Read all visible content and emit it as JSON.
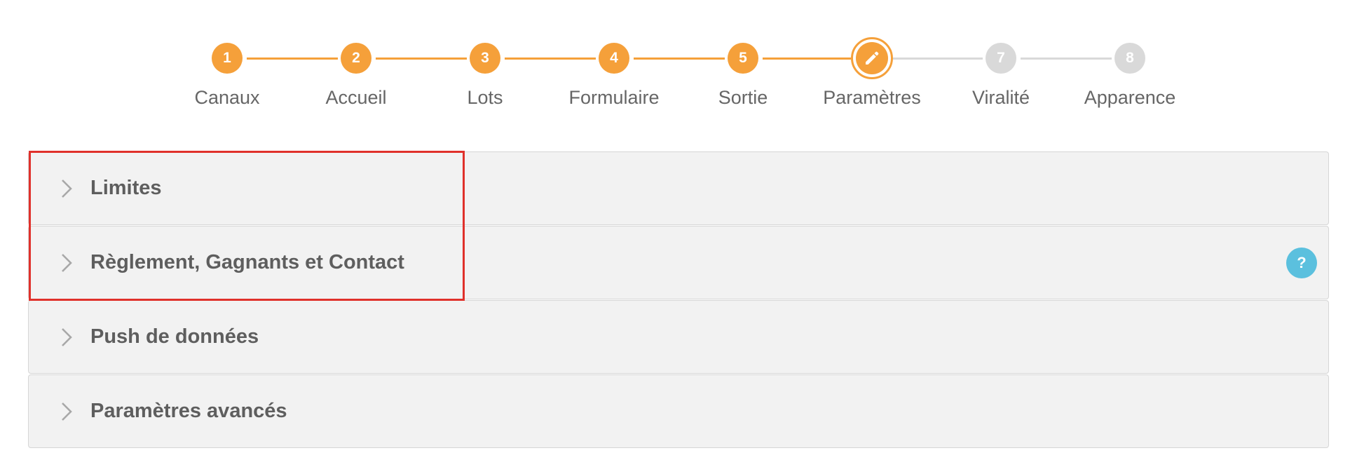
{
  "stepper": {
    "steps": [
      {
        "number": "1",
        "label": "Canaux",
        "state": "done"
      },
      {
        "number": "2",
        "label": "Accueil",
        "state": "done"
      },
      {
        "number": "3",
        "label": "Lots",
        "state": "done"
      },
      {
        "number": "4",
        "label": "Formulaire",
        "state": "done"
      },
      {
        "number": "5",
        "label": "Sortie",
        "state": "done"
      },
      {
        "number": "",
        "label": "Paramètres",
        "state": "current",
        "icon": "pencil-icon"
      },
      {
        "number": "7",
        "label": "Viralité",
        "state": "todo"
      },
      {
        "number": "8",
        "label": "Apparence",
        "state": "todo"
      }
    ]
  },
  "accordion": {
    "panels": [
      {
        "title": "Limites",
        "icon": "chevron-right-icon"
      },
      {
        "title": "Règlement, Gagnants et Contact",
        "icon": "chevron-right-icon",
        "help": "?"
      },
      {
        "title": "Push de données",
        "icon": "chevron-right-icon"
      },
      {
        "title": "Paramètres avancés",
        "icon": "chevron-right-icon"
      }
    ]
  },
  "colors": {
    "accent": "#f5a03a",
    "inactive": "#d9d9d9",
    "panel_bg": "#f2f2f2",
    "help_badge": "#5bc0de",
    "highlight": "#e0312b"
  }
}
